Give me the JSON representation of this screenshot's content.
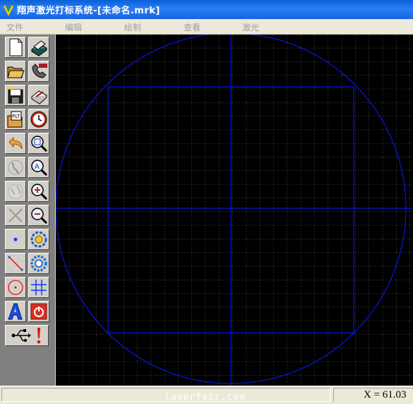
{
  "window": {
    "title": "翔声激光打标系统-[未命名.mrk]"
  },
  "menu": {
    "items": [
      "文件",
      "编辑",
      "绘制",
      "查看",
      "激光"
    ]
  },
  "toolbar": {
    "buttons": [
      "new-file-icon",
      "laser-print-icon",
      "open-folder-icon",
      "phone-handset-icon",
      "save-icon",
      "notebook-pencil-icon",
      "plt-import-icon",
      "clock-icon",
      "undo-icon",
      "zoom-page-icon",
      "globe-icon",
      "zoom-text-icon",
      "globe-grey-icon",
      "zoom-in-icon",
      "delete-x-icon",
      "zoom-out-icon",
      "point-tool-icon",
      "rotate-gear-icon",
      "line-tool-icon",
      "gear-icon",
      "circle-tool-icon",
      "grid-array-icon",
      "text-tool-icon",
      "stop-power-icon",
      "usb-icon",
      "alert-icon"
    ],
    "colors": {
      "blue": "#0a3cff",
      "red": "#e01010"
    }
  },
  "canvas": {
    "background": "#000000",
    "grid_color": "#4a4a4a",
    "shape_color": "#0a14d0"
  },
  "statusbar": {
    "watermark": "laserfair.com",
    "coordinate": "X = 61.03"
  }
}
